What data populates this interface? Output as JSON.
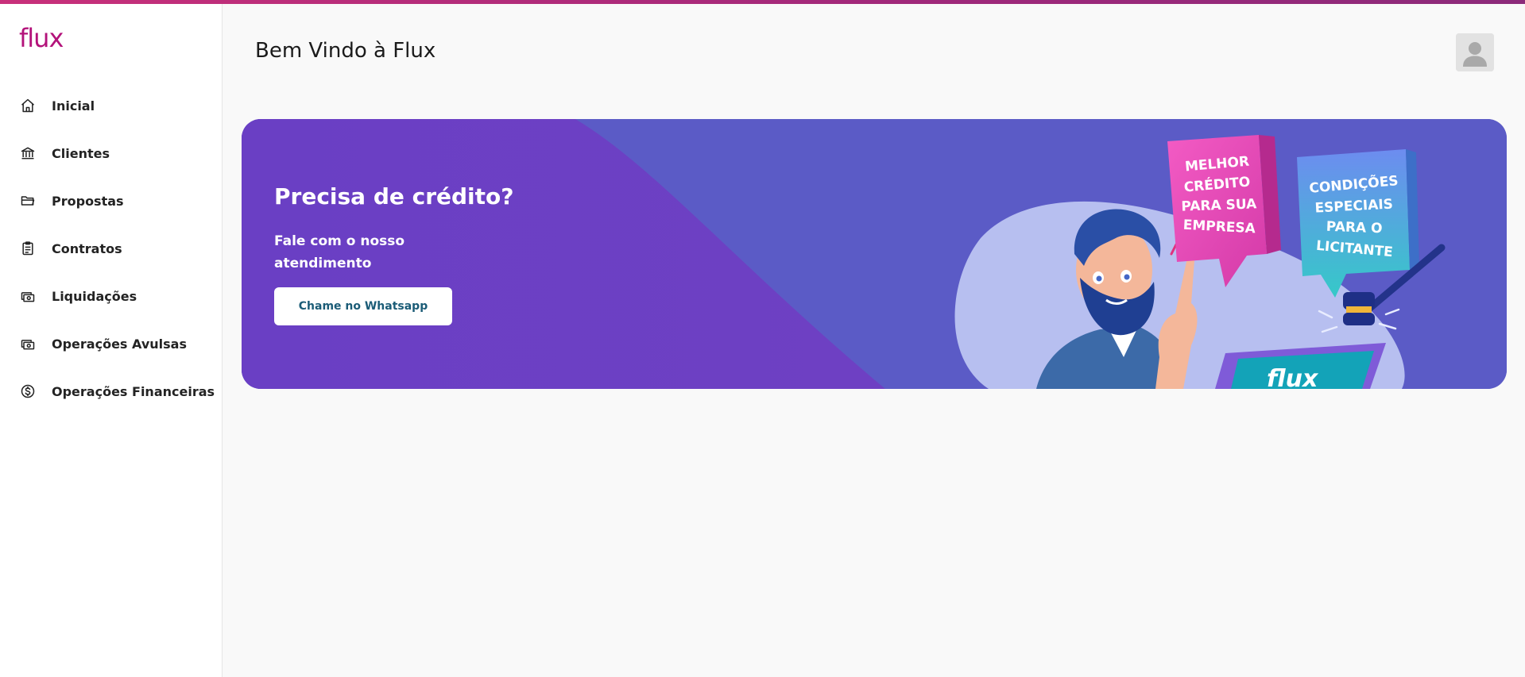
{
  "brand": {
    "logo_text": "flux",
    "accent": "#b3127a",
    "banner_color": "#5a59c7",
    "button_text_color": "#1b5c77"
  },
  "sidebar": {
    "items": [
      {
        "label": "Inicial",
        "icon": "home-icon"
      },
      {
        "label": "Clientes",
        "icon": "bank-icon"
      },
      {
        "label": "Propostas",
        "icon": "folder-icon"
      },
      {
        "label": "Contratos",
        "icon": "clipboard-icon"
      },
      {
        "label": "Liquidações",
        "icon": "cash-icon"
      },
      {
        "label": "Operações Avulsas",
        "icon": "cash-icon"
      },
      {
        "label": "Operações Financeiras",
        "icon": "dollar-circle-icon"
      }
    ]
  },
  "header": {
    "title": "Bem Vindo à Flux",
    "avatar_icon": "user-avatar-icon"
  },
  "banner": {
    "title": "Precisa de crédito?",
    "text": "Fale com o nosso atendimento",
    "button_label": "Chame no Whatsapp",
    "bubble_left": [
      "MELHOR",
      "CRÉDITO",
      "PARA SUA",
      "EMPRESA"
    ],
    "bubble_right": [
      "CONDIÇÕES",
      "ESPECIAIS",
      "PARA O",
      "LICITANTE"
    ],
    "laptop_text": "flux"
  }
}
